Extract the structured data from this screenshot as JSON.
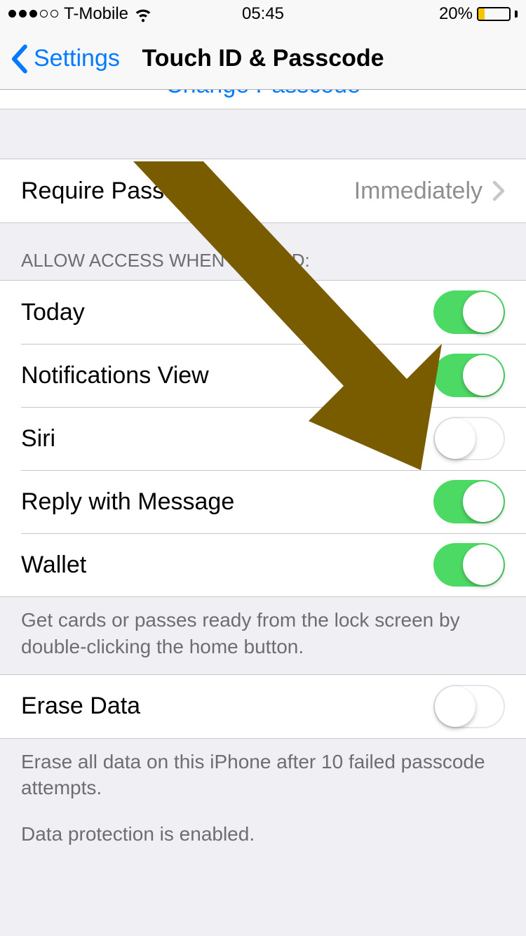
{
  "status": {
    "carrier": "T-Mobile",
    "time": "05:45",
    "battery_pct": "20%",
    "battery_level": 20
  },
  "nav": {
    "back_label": "Settings",
    "title": "Touch ID & Passcode"
  },
  "partial_row_label": "Change Passcode",
  "require": {
    "label": "Require Passcode",
    "value": "Immediately"
  },
  "allow_header": "ALLOW ACCESS WHEN LOCKED:",
  "allow_items": [
    {
      "label": "Today",
      "on": true
    },
    {
      "label": "Notifications View",
      "on": true
    },
    {
      "label": "Siri",
      "on": false
    },
    {
      "label": "Reply with Message",
      "on": true
    },
    {
      "label": "Wallet",
      "on": true
    }
  ],
  "wallet_footer": "Get cards or passes ready from the lock screen by double-clicking the home button.",
  "erase": {
    "label": "Erase Data",
    "on": false,
    "footer1": "Erase all data on this iPhone after 10 failed passcode attempts.",
    "footer2": "Data protection is enabled."
  },
  "colors": {
    "link": "#007aff",
    "switch_on": "#4cd964",
    "battery_low": "#f4c500",
    "annotation": "#7a5c00"
  }
}
